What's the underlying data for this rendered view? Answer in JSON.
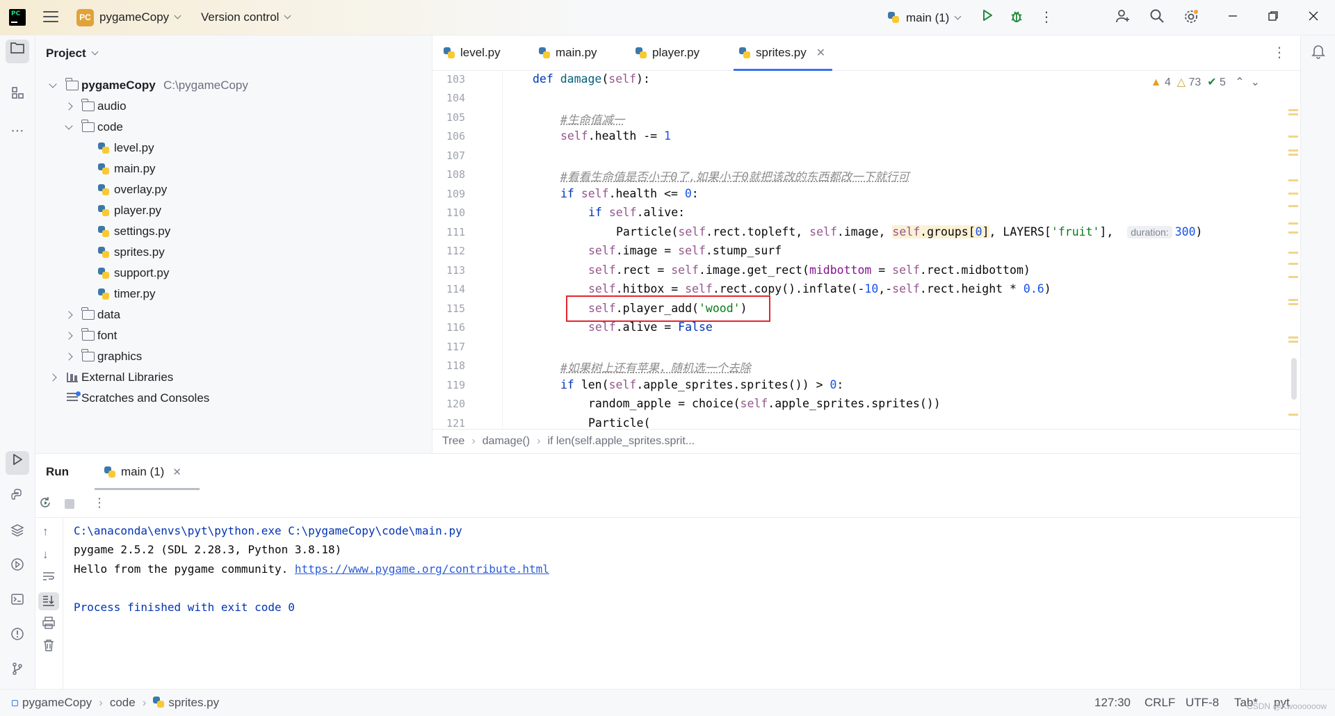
{
  "titlebar": {
    "project_badge": "PC",
    "project_name": "pygameCopy",
    "version_control": "Version control",
    "run_config": "main (1)"
  },
  "project_panel": {
    "title": "Project",
    "root": {
      "name": "pygameCopy",
      "path": "C:\\pygameCopy"
    },
    "items": [
      {
        "label": "audio"
      },
      {
        "label": "code"
      },
      {
        "label": "level.py"
      },
      {
        "label": "main.py"
      },
      {
        "label": "overlay.py"
      },
      {
        "label": "player.py"
      },
      {
        "label": "settings.py"
      },
      {
        "label": "sprites.py"
      },
      {
        "label": "support.py"
      },
      {
        "label": "timer.py"
      },
      {
        "label": "data"
      },
      {
        "label": "font"
      },
      {
        "label": "graphics"
      },
      {
        "label": "External Libraries"
      },
      {
        "label": "Scratches and Consoles"
      }
    ]
  },
  "tabs": [
    {
      "label": "level.py"
    },
    {
      "label": "main.py"
    },
    {
      "label": "player.py"
    },
    {
      "label": "sprites.py"
    }
  ],
  "editor": {
    "inspections": {
      "warnings": "4",
      "weak_warnings": "73",
      "ok": "5"
    },
    "line_numbers": [
      "103",
      "104",
      "105",
      "106",
      "107",
      "108",
      "109",
      "110",
      "111",
      "112",
      "113",
      "114",
      "115",
      "116",
      "117",
      "118",
      "119",
      "120",
      "121"
    ],
    "comments": {
      "c105": "#生命值减一",
      "c108": "#看看生命值是否小于0了,如果小于0就把该改的东西都改一下就行可",
      "c118": "#如果树上还有苹果，随机选一个去除"
    },
    "inlay_hint": "duration:",
    "breadcrumb": [
      "Tree",
      "damage()",
      "if len(self.apple_sprites.sprit..."
    ]
  },
  "run_panel": {
    "title": "Run",
    "tab": "main (1)",
    "output": {
      "line1": "C:\\anaconda\\envs\\pyt\\python.exe C:\\pygameCopy\\code\\main.py",
      "line2": "pygame 2.5.2 (SDL 2.28.3, Python 3.8.18)",
      "line3_text": "Hello from the pygame community. ",
      "line3_link": "https://www.pygame.org/contribute.html",
      "line4": "Process finished with exit code 0"
    }
  },
  "statusbar": {
    "crumbs": [
      "pygameCopy",
      "code",
      "sprites.py"
    ],
    "position": "127:30",
    "line_sep": "CRLF",
    "encoding": "UTF-8",
    "indent": "Tab*",
    "filetype": "pyt",
    "watermark": "CSDN @Kwoooooow"
  },
  "colors": {
    "accent": "#3574f0",
    "highlight_box": "#e3262c",
    "keyword": "#0033b3",
    "self": "#94558d",
    "string": "#067d17"
  }
}
